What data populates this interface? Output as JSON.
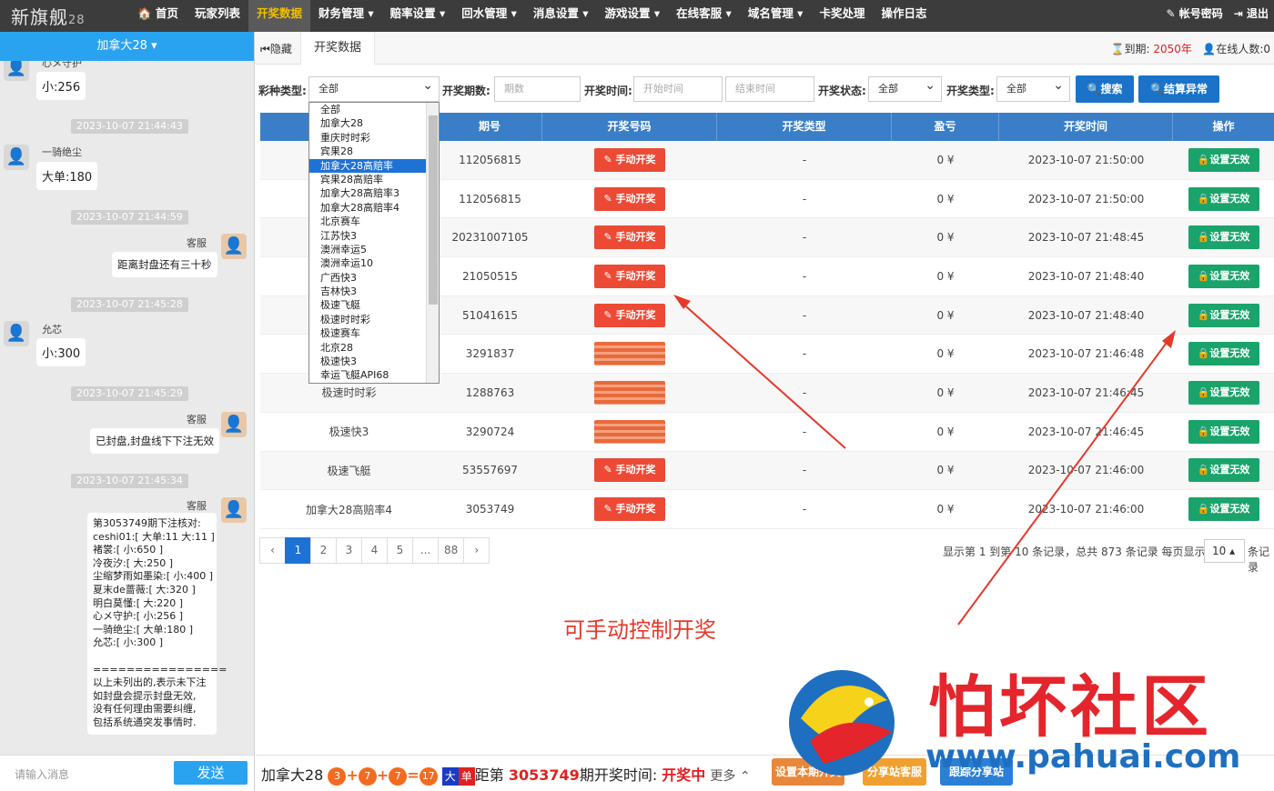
{
  "header": {
    "brand": "新旗舰",
    "brand_suffix": "28",
    "nav": [
      "首页",
      "玩家列表",
      "开奖数据",
      "财务管理 ▾",
      "赔率设置 ▾",
      "回水管理 ▾",
      "消息设置 ▾",
      "游戏设置 ▾",
      "在线客服 ▾",
      "域名管理 ▾",
      "卡奖处理",
      "操作日志"
    ],
    "account": "帐号密码",
    "logout": "退出"
  },
  "left": {
    "game_title": "加拿大28 ▾",
    "chat": [
      {
        "name": "心メ守护",
        "text": "小:256"
      },
      {
        "time": "2023-10-07 21:44:43",
        "name": "一骑绝尘",
        "text": "大单:180"
      },
      {
        "time": "2023-10-07 21:44:59",
        "name": "客服",
        "text": "距离封盘还有三十秒"
      },
      {
        "time": "2023-10-07 21:45:28",
        "name": "允芯",
        "text": "小:300"
      },
      {
        "time": "2023-10-07 21:45:29",
        "name": "客服",
        "text": "已封盘,封盘线下下注无效"
      },
      {
        "time": "2023-10-07 21:45:34",
        "name": "客服"
      }
    ],
    "long_message": [
      "第3053749期下注核对:",
      "ceshi01:[ 大单:11 大:11 ]",
      "褚裳:[ 小:650 ]",
      "冷夜汐:[ 大:250 ]",
      "尘缩梦雨如墨染:[ 小:400 ]",
      "夏末de蔷薇:[ 大:320 ]",
      "明白莫懂:[ 大:220 ]",
      "心メ守护:[ 小:256 ]",
      "一骑绝尘:[ 大单:180 ]",
      "允芯:[ 小:300 ]",
      "",
      "================",
      "以上未列出的,表示未下注",
      "如封盘会提示封盘无效,",
      "没有任何理由需要纠缠,",
      "包括系统通突发事情时."
    ],
    "input_placeholder": "请输入消息",
    "send": "发送"
  },
  "tabs": {
    "hide": "隐藏",
    "current": "开奖数据"
  },
  "status": {
    "expire_label": "到期:",
    "expire_value": "2050年",
    "online": "在线人数:0"
  },
  "filters": {
    "type_label": "彩种类型:",
    "type_value": "全部",
    "period_label": "开奖期数:",
    "period_placeholder": "期数",
    "time_label": "开奖时间:",
    "start_placeholder": "开始时间",
    "end_placeholder": "结束时间",
    "state_label": "开奖状态:",
    "state_value": "全部",
    "kind_label": "开奖类型:",
    "kind_value": "全部",
    "search": "搜索",
    "settle": "结算异常"
  },
  "dropdown": [
    "全部",
    "加拿大28",
    "重庆时时彩",
    "宾果28",
    "加拿大28高赔率",
    "宾果28高赔率",
    "加拿大28高赔率3",
    "加拿大28高赔率4",
    "北京赛车",
    "江苏快3",
    "澳洲幸运5",
    "澳洲幸运10",
    "广西快3",
    "吉林快3",
    "极速飞艇",
    "极速时时彩",
    "极速赛车",
    "北京28",
    "极速快3",
    "幸运飞艇API68"
  ],
  "table": {
    "headers": [
      "",
      "期号",
      "开奖号码",
      "开奖类型",
      "盈亏",
      "开奖时间",
      "操作"
    ],
    "manual": "手动开奖",
    "invalid": "设置无效",
    "rows": [
      {
        "type": "",
        "period": "112056815",
        "kind": "-",
        "pl": "0 ¥",
        "time": "2023-10-07 21:50:00"
      },
      {
        "type": "",
        "period": "112056815",
        "kind": "-",
        "pl": "0 ¥",
        "time": "2023-10-07 21:50:00"
      },
      {
        "type": "",
        "period": "20231007105",
        "kind": "-",
        "pl": "0 ¥",
        "time": "2023-10-07 21:48:45"
      },
      {
        "type": "",
        "period": "21050515",
        "kind": "-",
        "pl": "0 ¥",
        "time": "2023-10-07 21:48:40"
      },
      {
        "type": "",
        "period": "51041615",
        "kind": "-",
        "pl": "0 ¥",
        "time": "2023-10-07 21:48:40"
      },
      {
        "type": "",
        "period": "3291837",
        "kind": "-",
        "pl": "0 ¥",
        "time": "2023-10-07 21:46:48"
      },
      {
        "type": "极速时时彩",
        "period": "1288763",
        "kind": "-",
        "pl": "0 ¥",
        "time": "2023-10-07 21:46:45"
      },
      {
        "type": "极速快3",
        "period": "3290724",
        "kind": "-",
        "pl": "0 ¥",
        "time": "2023-10-07 21:46:45"
      },
      {
        "type": "极速飞艇",
        "period": "53557697",
        "kind": "-",
        "pl": "0 ¥",
        "time": "2023-10-07 21:46:00"
      },
      {
        "type": "加拿大28高赔率4",
        "period": "3053749",
        "kind": "-",
        "pl": "0 ¥",
        "time": "2023-10-07 21:46:00"
      }
    ]
  },
  "pager": {
    "pages": [
      "‹",
      "1",
      "2",
      "3",
      "4",
      "5",
      "...",
      "88",
      "›"
    ],
    "info": "显示第 1 到第 10 条记录，总共 873 条记录  每页显示",
    "size": "10 ▴",
    "after": "条记录"
  },
  "annotation": "可手动控制开奖",
  "bottom": {
    "game": "加拿大28",
    "balls": [
      "3",
      "7",
      "7",
      "17"
    ],
    "big": "大",
    "single": "单",
    "text1": "距第 ",
    "period": "3053749",
    "text2": "期开奖时间: ",
    "state": "开奖中",
    "more": "更多 ⌃",
    "btn1": "设置本期开奖",
    "btn2": "分享站客服",
    "btn3": "跟踪分享站"
  },
  "watermark": {
    "cn": "怕坏社区",
    "url": "www.pahuai.com"
  },
  "colors": {
    "primary": "#1e72d6",
    "red": "#ec4a35",
    "green": "#1aa36a",
    "topbar": "#3c3c3c",
    "chat_header": "#29a3f0"
  }
}
